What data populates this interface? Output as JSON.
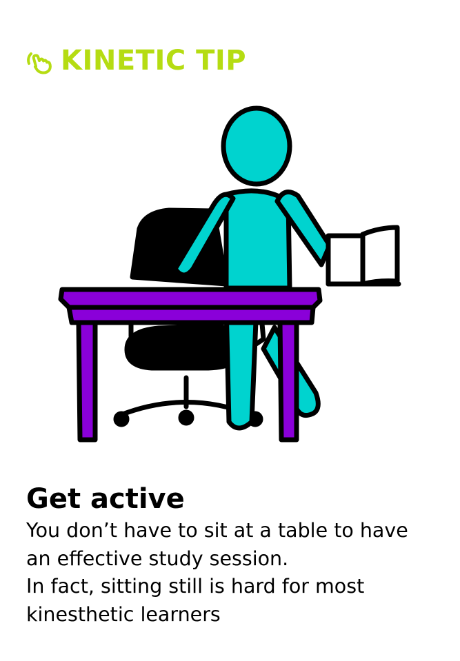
{
  "header": {
    "icon": "tap-hand-icon",
    "title": "KINETIC TIP",
    "accent_color": "#b5dc12"
  },
  "illustration": {
    "subject": "person-at-desk-reading",
    "colors": {
      "person": "#00d3cf",
      "desk": "#8a00d9",
      "chair": "#000000",
      "book": "#ffffff",
      "outline": "#000000"
    }
  },
  "tip": {
    "title": "Get active",
    "lines": [
      "You don’t have to sit at a table to have",
      "an effective study session.",
      "In fact, sitting still is hard for most",
      "kinesthetic learners"
    ]
  }
}
